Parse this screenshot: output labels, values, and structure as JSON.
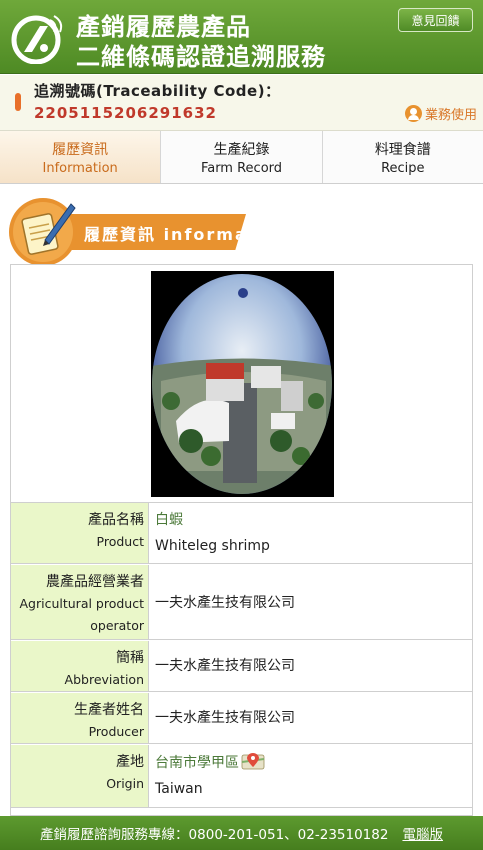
{
  "header": {
    "title_line1": "產銷履歷農產品",
    "title_line2": "二維條碼認證追溯服務",
    "feedback_label": "意見回饋",
    "logo_icon": "traceability-logo-icon"
  },
  "trace": {
    "label": "追溯號碼(Traceability Code)：",
    "code": "2205115206291632",
    "business_label": "業務使用",
    "business_icon": "user-icon"
  },
  "tabs": [
    {
      "zh": "履歷資訊",
      "en": "Information",
      "active": true
    },
    {
      "zh": "生產紀錄",
      "en": "Farm Record",
      "active": false
    },
    {
      "zh": "料理食譜",
      "en": "Recipe",
      "active": false
    }
  ],
  "section": {
    "title": "履歷資訊 information",
    "icon": "notebook-pen-icon"
  },
  "info": {
    "product": {
      "label_zh": "產品名稱",
      "label_en": "Product",
      "value_zh": "白蝦",
      "value_en": "Whiteleg shrimp"
    },
    "operator": {
      "label_zh": "農產品經營業者",
      "label_en1": "Agricultural product",
      "label_en2": "operator",
      "value": "一夫水產生技有限公司"
    },
    "abbreviation": {
      "label_zh": "簡稱",
      "label_en": "Abbreviation",
      "value": "一夫水產生技有限公司"
    },
    "producer": {
      "label_zh": "生產者姓名",
      "label_en": "Producer",
      "value": "一夫水產生技有限公司"
    },
    "origin": {
      "label_zh": "產地",
      "label_en": "Origin",
      "value_zh": "台南市學甲區",
      "value_en": "Taiwan",
      "map_icon": "map-pin-icon"
    }
  },
  "footer": {
    "hotline": "產銷履歷諮詢服務專線：0800-201-051、02-23510182",
    "desktop_link": "電腦版"
  },
  "colors": {
    "header_green": "#4e8a24",
    "accent_orange": "#e8922f",
    "code_red": "#c0392b",
    "label_bg": "#eaf7c9",
    "link_green": "#4c7a3a"
  }
}
